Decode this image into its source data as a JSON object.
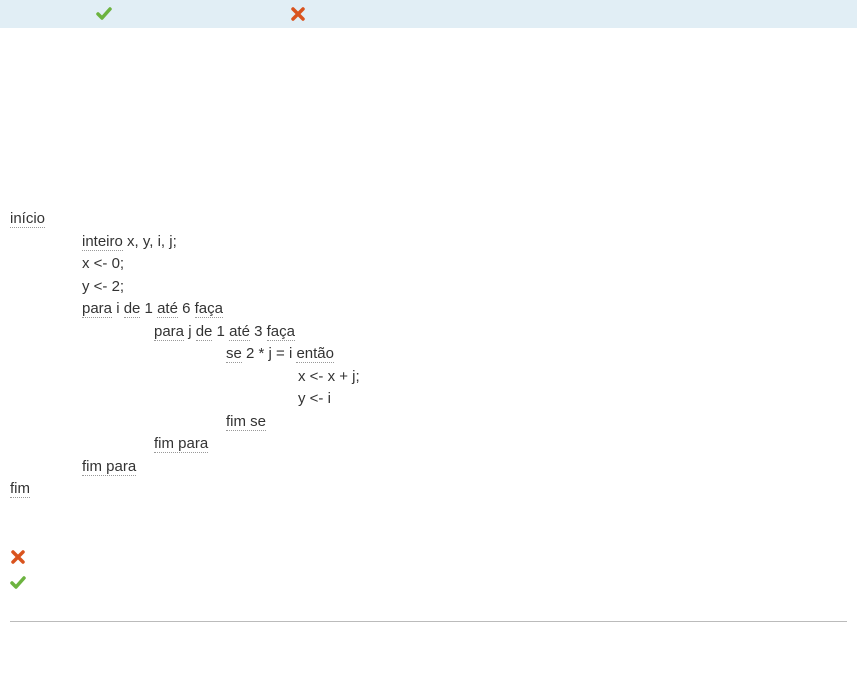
{
  "code": {
    "inicio": "início",
    "decl_kw": "inteiro",
    "decl_rest": " x, y, i, j;",
    "x_assign": "x <- 0;",
    "y_assign": "y <- 2;",
    "outer_para": "para",
    "outer_var": " i ",
    "outer_de": "de",
    "outer_from": " 1 ",
    "outer_ate": "até",
    "outer_to": " 6 ",
    "outer_faca": "faça",
    "inner_para": "para",
    "inner_var": " j ",
    "inner_de": "de",
    "inner_from": " 1 ",
    "inner_ate": "até",
    "inner_to": " 3 ",
    "inner_faca": "faça",
    "se": "se",
    "cond": " 2 * j = i ",
    "entao": "então",
    "body_x": "x <- x + j;",
    "body_y": "y <- i",
    "fimse": "fim se",
    "inner_fimpara": "fim para",
    "outer_fimpara": "fim para",
    "fim": "fim"
  },
  "icons": {
    "check_color": "#6cb33f",
    "cross_color": "#d9531e"
  }
}
